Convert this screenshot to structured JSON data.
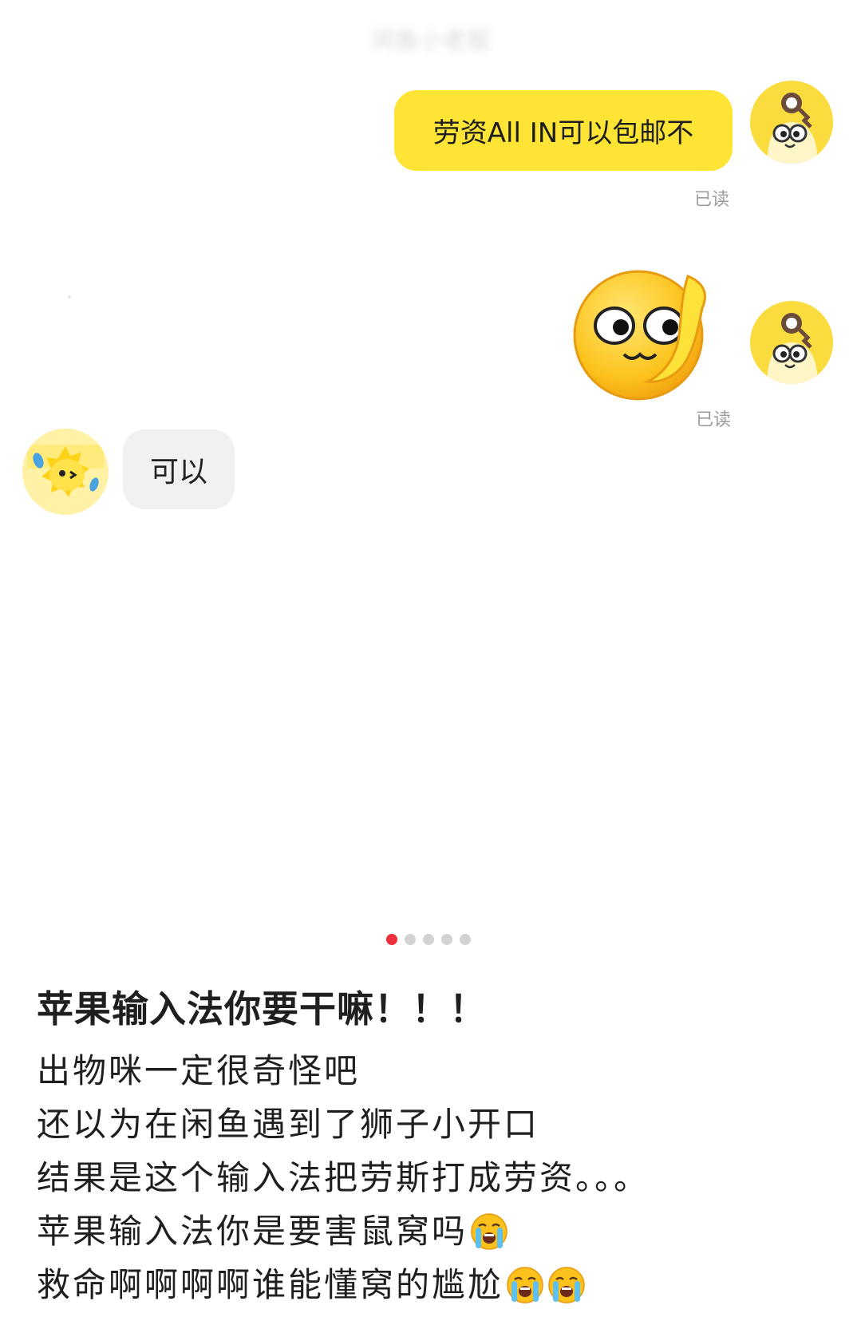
{
  "header": {
    "contact_name": "闲鱼小老板"
  },
  "conversation": {
    "messages": [
      {
        "sender": "self",
        "text": "劳资All IN可以包邮不",
        "status": "已读"
      },
      {
        "sender": "self",
        "sticker": "wave-face-sticker-icon",
        "status": "已读"
      },
      {
        "sender": "other",
        "text": "可以"
      }
    ]
  },
  "pager": {
    "total": 5,
    "current": 1
  },
  "post": {
    "title": "苹果输入法你要干嘛！！！",
    "lines": [
      "出物咪一定很奇怪吧",
      "还以为在闲鱼遇到了狮子小开口",
      "结果是这个输入法把劳斯打成劳资。。。",
      "苹果输入法你是要害鼠窝吗",
      "救命啊啊啊啊谁能懂窝的尴尬"
    ],
    "line_emoji_counts": [
      0,
      0,
      0,
      1,
      2
    ],
    "emoji_icon": "loudly-crying-face-icon"
  },
  "colors": {
    "self_bubble": "#fde435",
    "other_bubble": "#f1f1f3",
    "pager_active": "#ee2f3c",
    "pager_inactive": "#d3d3d3",
    "read_status": "#9b9b9b"
  }
}
